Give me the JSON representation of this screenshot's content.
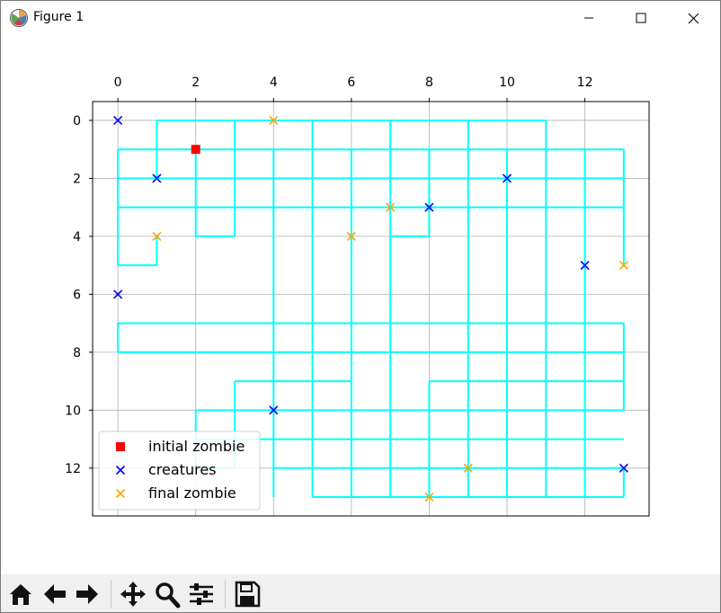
{
  "window": {
    "title": "Figure 1",
    "icon": "matplotlib-icon",
    "controls": [
      "minimize-icon",
      "maximize-icon",
      "close-icon"
    ]
  },
  "toolbar": {
    "buttons": [
      "home-icon",
      "back-arrow-icon",
      "forward-arrow-icon",
      "pan-icon",
      "zoom-icon",
      "configure-subplots-icon",
      "save-icon"
    ]
  },
  "chart_data": {
    "type": "scatter",
    "title": "",
    "xlabel": "",
    "ylabel": "",
    "xlim": [
      -0.65,
      13.65
    ],
    "ylim": [
      13.65,
      -0.65
    ],
    "x_axis_position": "top",
    "y_inverted": true,
    "grid": true,
    "xticks": [
      0,
      2,
      4,
      6,
      8,
      10,
      12
    ],
    "yticks": [
      0,
      2,
      4,
      6,
      8,
      10,
      12
    ],
    "grid_line_color": "#00ffff",
    "grid_segments": [
      [
        [
          1,
          0
        ],
        [
          11,
          0
        ]
      ],
      [
        [
          1,
          0
        ],
        [
          1,
          2
        ]
      ],
      [
        [
          3,
          0
        ],
        [
          3,
          4
        ]
      ],
      [
        [
          5,
          0
        ],
        [
          5,
          13
        ]
      ],
      [
        [
          7,
          0
        ],
        [
          7,
          13
        ]
      ],
      [
        [
          9,
          0
        ],
        [
          9,
          13
        ]
      ],
      [
        [
          11,
          0
        ],
        [
          11,
          13
        ]
      ],
      [
        [
          0,
          1
        ],
        [
          13,
          1
        ]
      ],
      [
        [
          0,
          1
        ],
        [
          0,
          5
        ]
      ],
      [
        [
          2,
          1
        ],
        [
          2,
          4
        ]
      ],
      [
        [
          4,
          1
        ],
        [
          4,
          13
        ]
      ],
      [
        [
          6,
          1
        ],
        [
          6,
          13
        ]
      ],
      [
        [
          8,
          1
        ],
        [
          8,
          4
        ]
      ],
      [
        [
          10,
          1
        ],
        [
          10,
          13
        ]
      ],
      [
        [
          12,
          1
        ],
        [
          12,
          13
        ]
      ],
      [
        [
          13,
          1
        ],
        [
          13,
          5
        ]
      ],
      [
        [
          0,
          2
        ],
        [
          13,
          2
        ]
      ],
      [
        [
          0,
          3
        ],
        [
          13,
          3
        ]
      ],
      [
        [
          2,
          4
        ],
        [
          3,
          4
        ]
      ],
      [
        [
          7,
          4
        ],
        [
          8,
          4
        ]
      ],
      [
        [
          0,
          5
        ],
        [
          1,
          5
        ]
      ],
      [
        [
          1,
          4
        ],
        [
          1,
          5
        ]
      ],
      [
        [
          0,
          7
        ],
        [
          13,
          7
        ]
      ],
      [
        [
          0,
          7
        ],
        [
          0,
          8
        ]
      ],
      [
        [
          0,
          8
        ],
        [
          13,
          8
        ]
      ],
      [
        [
          13,
          7
        ],
        [
          13,
          10
        ]
      ],
      [
        [
          3,
          9
        ],
        [
          6,
          9
        ]
      ],
      [
        [
          3,
          9
        ],
        [
          3,
          12
        ]
      ],
      [
        [
          8,
          9
        ],
        [
          13,
          9
        ]
      ],
      [
        [
          8,
          9
        ],
        [
          8,
          13
        ]
      ],
      [
        [
          2,
          10
        ],
        [
          13,
          10
        ]
      ],
      [
        [
          2,
          10
        ],
        [
          2,
          12
        ]
      ],
      [
        [
          2,
          11
        ],
        [
          13,
          11
        ]
      ],
      [
        [
          4,
          12
        ],
        [
          13,
          12
        ]
      ],
      [
        [
          5,
          13
        ],
        [
          13,
          13
        ]
      ],
      [
        [
          13,
          12
        ],
        [
          13,
          13
        ]
      ],
      [
        [
          2,
          12
        ],
        [
          3,
          12
        ]
      ]
    ],
    "series": [
      {
        "name": "initial zombie",
        "marker": "square",
        "color": "#ff0000",
        "points": [
          [
            2,
            1
          ]
        ]
      },
      {
        "name": "creatures",
        "marker": "x",
        "color": "#0000ff",
        "points": [
          [
            0,
            0
          ],
          [
            1,
            2
          ],
          [
            8,
            3
          ],
          [
            10,
            2
          ],
          [
            0,
            6
          ],
          [
            12,
            5
          ],
          [
            4,
            10
          ],
          [
            13,
            12
          ]
        ]
      },
      {
        "name": "final zombie",
        "marker": "x",
        "color": "#ffa500",
        "points": [
          [
            4,
            0
          ],
          [
            1,
            4
          ],
          [
            6,
            4
          ],
          [
            7,
            3
          ],
          [
            13,
            5
          ],
          [
            9,
            12
          ],
          [
            8,
            13
          ]
        ]
      }
    ],
    "legend": {
      "placement": "lower-left",
      "entries": [
        "initial zombie",
        "creatures",
        "final zombie"
      ]
    }
  }
}
